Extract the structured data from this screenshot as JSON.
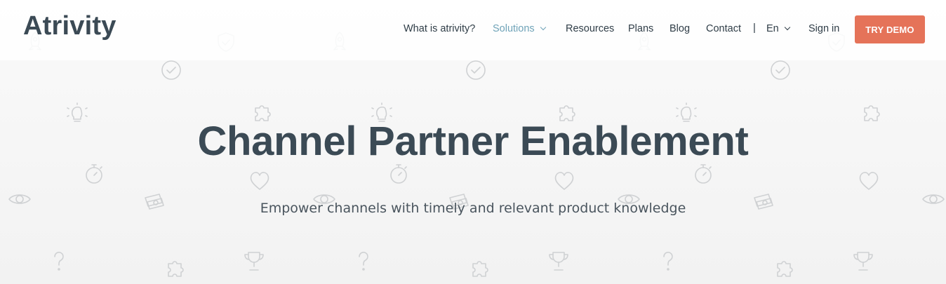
{
  "brand": {
    "logo": "Atrivity"
  },
  "nav": {
    "items": [
      {
        "label": "What is atrivity?"
      },
      {
        "label": "Solutions"
      },
      {
        "label": "Resources"
      },
      {
        "label": "Plans"
      },
      {
        "label": "Blog"
      },
      {
        "label": "Contact"
      }
    ],
    "separator": "|",
    "language": "En",
    "sign_in": "Sign in",
    "cta": "TRY DEMO"
  },
  "hero": {
    "title": "Channel Partner Enablement",
    "subtitle": "Empower channels with timely and relevant product knowledge"
  },
  "colors": {
    "text": "#3b4a55",
    "accent": "#6fa3b8",
    "cta": "#e57359",
    "pattern": "#cfd1d3"
  },
  "icons": [
    "rocket-icon",
    "shield-icon",
    "check-circle-icon",
    "lightbulb-icon",
    "puzzle-icon",
    "stopwatch-icon",
    "heart-icon",
    "eye-icon",
    "money-icon",
    "question-icon",
    "trophy-icon"
  ]
}
